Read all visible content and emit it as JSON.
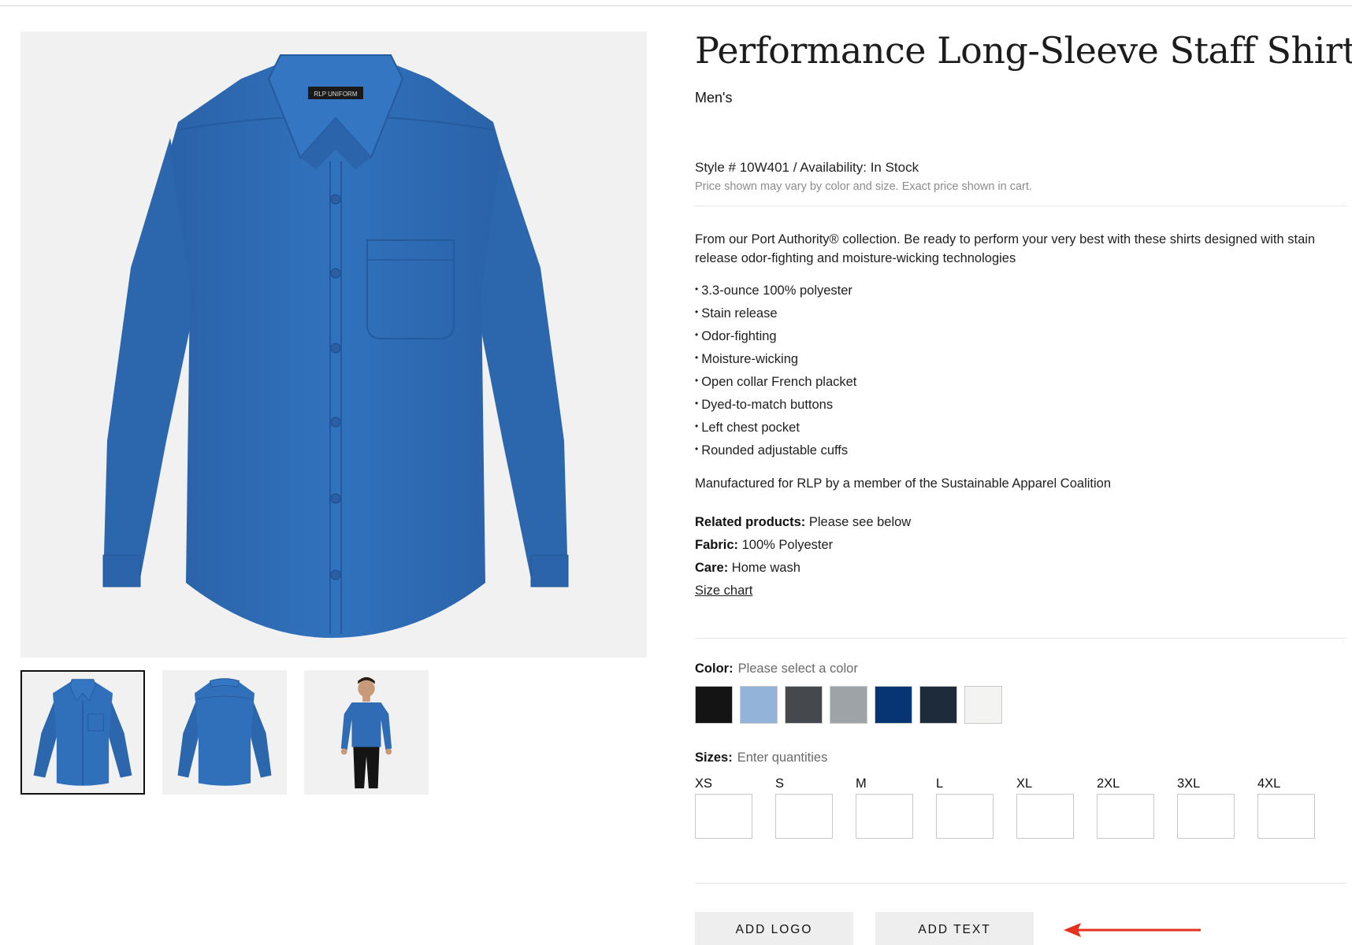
{
  "colors": {
    "shirt": "#2f6cb5",
    "annotation_arrow": "#e5311f",
    "button_bg": "#eeeeee"
  },
  "gallery": {
    "main_image": "blue-long-sleeve-shirt-front",
    "collar_tag": "RLP UNIFORM",
    "thumbnails": [
      {
        "name": "shirt-front",
        "selected": true
      },
      {
        "name": "shirt-back",
        "selected": false
      },
      {
        "name": "model-wearing-shirt",
        "selected": false
      }
    ]
  },
  "product": {
    "title": "Performance Long-Sleeve Staff Shirt",
    "gender": "Men's",
    "style_availability": "Style # 10W401 / Availability: In Stock",
    "price_note": "Price shown may vary by color and size. Exact price shown in cart.",
    "description": "From our Port Authority® collection. Be ready to perform your very best with these shirts designed with stain release odor-fighting and moisture-wicking technologies",
    "features": [
      "3.3-ounce 100% polyester",
      "Stain release",
      "Odor-fighting",
      "Moisture-wicking",
      "Open collar French placket",
      "Dyed-to-match buttons",
      "Left chest pocket",
      "Rounded adjustable cuffs"
    ],
    "manufactured": "Manufactured for RLP by a member of the Sustainable Apparel Coalition",
    "related_label": "Related products:",
    "related_value": "Please see below",
    "fabric_label": "Fabric:",
    "fabric_value": "100% Polyester",
    "care_label": "Care:",
    "care_value": "Home wash",
    "size_chart_link": "Size chart"
  },
  "color_select": {
    "label": "Color:",
    "hint": "Please select a color",
    "swatches": [
      "#141414",
      "#93b4d8",
      "#45494e",
      "#9ea3a8",
      "#073574",
      "#1d2b3a",
      "#f3f3f1"
    ]
  },
  "size_select": {
    "label": "Sizes:",
    "hint": "Enter quantities",
    "sizes": [
      "XS",
      "S",
      "M",
      "L",
      "XL",
      "2XL",
      "3XL",
      "4XL"
    ]
  },
  "actions": {
    "add_logo": "ADD LOGO",
    "add_text": "ADD TEXT"
  }
}
